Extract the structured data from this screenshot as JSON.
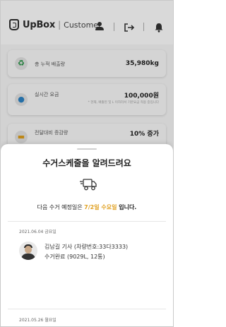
{
  "header": {
    "brand": "UpBox",
    "separator": "|",
    "role": "Customer",
    "icons": [
      "user-icon",
      "logout-icon",
      "bell-icon"
    ]
  },
  "summary": [
    {
      "icon": "recycle-icon",
      "label": "총 누적 배출량",
      "value": "35,980kg"
    },
    {
      "icon": "hand-money-icon",
      "label": "실시간 요금",
      "value": "100,000원",
      "note": "* 현재, 배출된 및 L 이하라서 기본요금 적용 중입니다"
    },
    {
      "icon": "truck-icon",
      "label": "전달대비 증감량",
      "value": "10% 증가"
    }
  ],
  "sheet": {
    "title": "수거스케줄을 알려드려요",
    "notice_prefix": "다음 수거 예정일은 ",
    "notice_date": "7/2일 수요일",
    "notice_suffix": " 입니다.",
    "records": [
      {
        "date": "2021.06.04 금요일",
        "driver": "김남길 기사 (차량번호:33다3333)",
        "status": "수거완료 (9029L, 12통)"
      },
      {
        "date": "2021.05.26 월요일"
      }
    ]
  },
  "colors": {
    "accent": "#e0a020",
    "recycle": "#1a8a3a"
  }
}
